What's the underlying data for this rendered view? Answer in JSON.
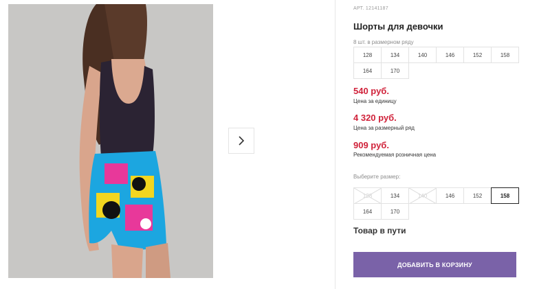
{
  "product": {
    "article": "АРТ. 12141187",
    "title": "Шорты для девочки",
    "row_count_label": "8 шт. в размерном ряду"
  },
  "size_range": [
    "128",
    "134",
    "140",
    "146",
    "152",
    "158",
    "164",
    "170"
  ],
  "prices": {
    "unit_price": "540 руб.",
    "unit_label": "Цена за единицу",
    "row_price": "4 320 руб.",
    "row_label": "Цена за размерный ряд",
    "retail_price": "909 руб.",
    "retail_label": "Рекомендуемая розничная цена"
  },
  "size_picker": {
    "label": "Выберите размер:",
    "options": [
      {
        "value": "128",
        "available": false
      },
      {
        "value": "134",
        "available": true
      },
      {
        "value": "140",
        "available": false
      },
      {
        "value": "146",
        "available": true
      },
      {
        "value": "152",
        "available": true
      },
      {
        "value": "158",
        "available": true,
        "selected": true
      },
      {
        "value": "164",
        "available": true
      },
      {
        "value": "170",
        "available": true
      }
    ]
  },
  "status": "Товар в пути",
  "add_to_cart_label": "ДОБАВИТЬ В КОРЗИНУ",
  "colors": {
    "price": "#d0223a",
    "button": "#7a62a8"
  },
  "icons": {
    "next": "chevron-right-icon"
  }
}
